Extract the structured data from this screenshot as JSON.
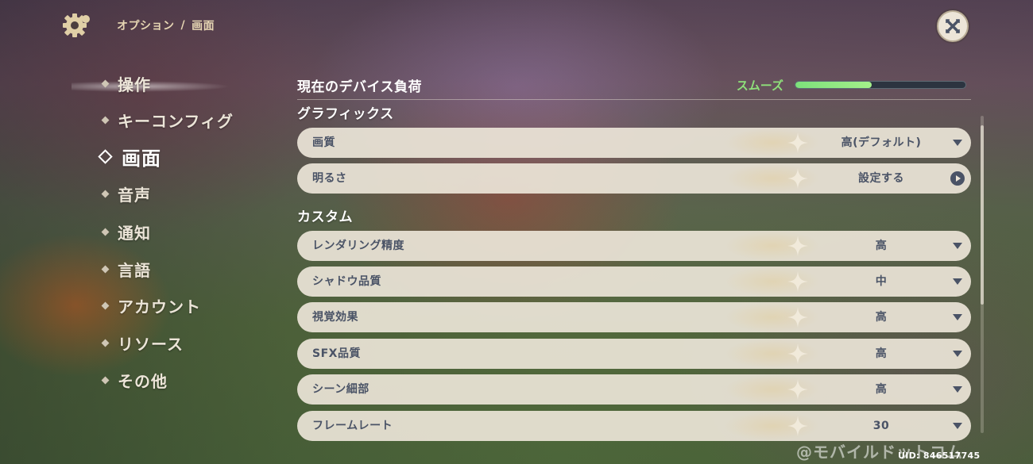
{
  "header": {
    "breadcrumb_root": "オプション",
    "breadcrumb_sep": "/",
    "breadcrumb_current": "画面"
  },
  "sidebar": {
    "items": [
      {
        "label": "操作"
      },
      {
        "label": "キーコンフィグ"
      },
      {
        "label": "画面",
        "active": true
      },
      {
        "label": "音声"
      },
      {
        "label": "通知"
      },
      {
        "label": "言語"
      },
      {
        "label": "アカウント"
      },
      {
        "label": "リソース"
      },
      {
        "label": "その他"
      }
    ]
  },
  "device_load": {
    "label": "現在のデバイス負荷",
    "status": "スムーズ",
    "status_color": "#8ee07a",
    "level": 0.45
  },
  "graphics": {
    "title": "グラフィックス",
    "rows": [
      {
        "label": "画質",
        "value": "高(デフォルト)",
        "control": "dropdown"
      },
      {
        "label": "明るさ",
        "value": "設定する",
        "control": "arrow"
      }
    ]
  },
  "custom": {
    "title": "カスタム",
    "rows": [
      {
        "label": "レンダリング精度",
        "value": "高",
        "control": "dropdown"
      },
      {
        "label": "シャドウ品質",
        "value": "中",
        "control": "dropdown"
      },
      {
        "label": "視覚効果",
        "value": "高",
        "control": "dropdown"
      },
      {
        "label": "SFX品質",
        "value": "高",
        "control": "dropdown"
      },
      {
        "label": "シーン細部",
        "value": "高",
        "control": "dropdown"
      },
      {
        "label": "フレームレート",
        "value": "30",
        "control": "dropdown"
      }
    ]
  },
  "footer": {
    "watermark": "@モバイルドットコム",
    "uid": "UID: 846517745"
  },
  "icons": {
    "settings": "gear-icon",
    "close": "close-icon",
    "dropdown": "chevron-down-icon",
    "arrow": "arrow-right-icon"
  }
}
